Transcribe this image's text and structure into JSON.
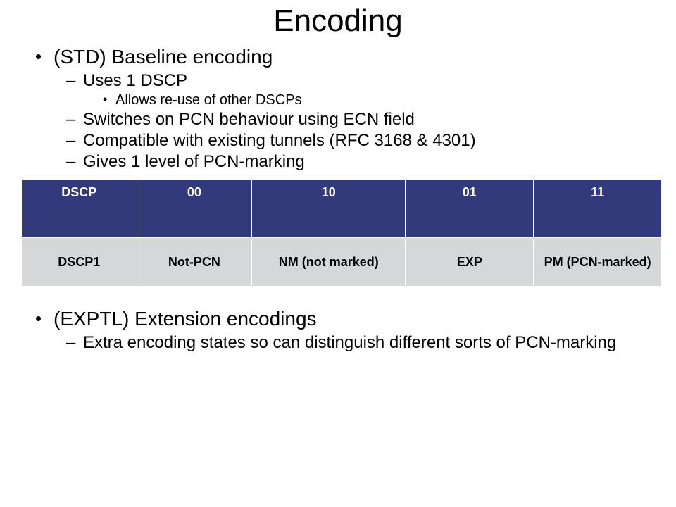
{
  "title": "Encoding",
  "bullets1": {
    "item": "(STD) Baseline encoding",
    "subs": {
      "s1": "Uses 1 DSCP",
      "s1a": "Allows re-use of other DSCPs",
      "s2": "Switches on PCN behaviour using ECN field",
      "s3": "Compatible with existing tunnels (RFC 3168 & 4301)",
      "s4": "Gives 1 level of PCN-marking"
    }
  },
  "table": {
    "headers": {
      "c0": "DSCP",
      "c1": "00",
      "c2": "10",
      "c3": "01",
      "c4": "11"
    },
    "row": {
      "c0": "DSCP1",
      "c1": "Not-PCN",
      "c2": "NM\n(not marked)",
      "c3": "EXP",
      "c4": "PM\n(PCN-marked)"
    }
  },
  "bullets2": {
    "item": "(EXPTL) Extension encodings",
    "subs": {
      "s1": "Extra encoding states so can distinguish different sorts of PCN-marking"
    }
  }
}
